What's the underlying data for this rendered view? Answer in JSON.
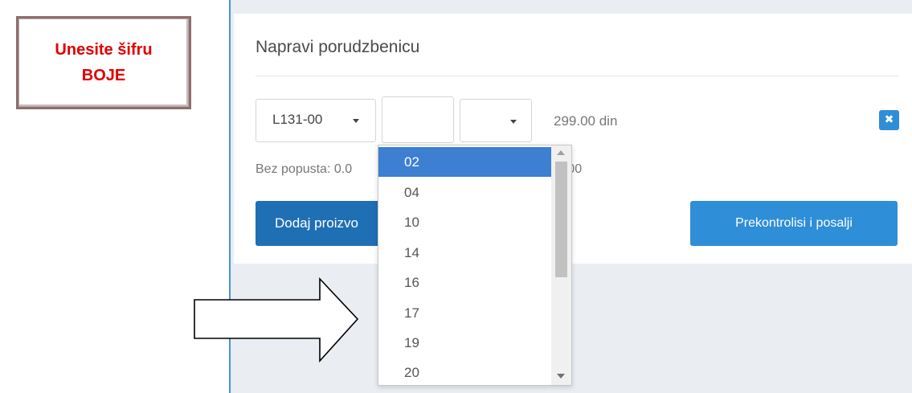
{
  "callout": {
    "line1": "Unesite šifru",
    "line2": "BOJE"
  },
  "panel": {
    "title": "Napravi porudzbenicu"
  },
  "order_row": {
    "product_code": "L131-00",
    "color_code_input": "",
    "shade_select": "",
    "price": "299.00 din",
    "remove_icon": "✖",
    "discount_text": "Bez popusta: 0.0",
    "total_text": "0.00"
  },
  "buttons": {
    "add_product": "Dodaj proizvo",
    "check_and_send": "Prekontrolisi i posalji"
  },
  "dropdown": {
    "selected": "02",
    "options": [
      "02",
      "04",
      "10",
      "14",
      "16",
      "17",
      "19",
      "20"
    ]
  },
  "colors": {
    "accent_blue": "#2f8ed8",
    "dark_blue": "#1f6fb5",
    "selection_blue": "#3d7fd1",
    "callout_red": "#e00000"
  }
}
